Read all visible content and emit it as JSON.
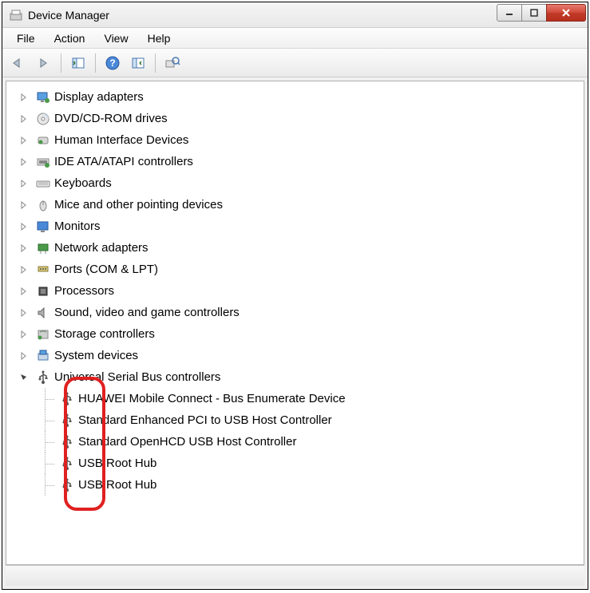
{
  "window": {
    "title": "Device Manager"
  },
  "menu": {
    "file": "File",
    "action": "Action",
    "view": "View",
    "help": "Help"
  },
  "toolbar": {
    "back": "back-icon",
    "forward": "forward-icon",
    "show_hide": "show-hide-tree-icon",
    "help": "help-icon",
    "action": "action-icon",
    "scan": "scan-hardware-icon"
  },
  "tree": [
    {
      "label": "Display adapters",
      "icon": "display",
      "expandable": true
    },
    {
      "label": "DVD/CD-ROM drives",
      "icon": "dvd",
      "expandable": true
    },
    {
      "label": "Human Interface Devices",
      "icon": "hid",
      "expandable": true
    },
    {
      "label": "IDE ATA/ATAPI controllers",
      "icon": "ide",
      "expandable": true
    },
    {
      "label": "Keyboards",
      "icon": "keyboard",
      "expandable": true
    },
    {
      "label": "Mice and other pointing devices",
      "icon": "mouse",
      "expandable": true
    },
    {
      "label": "Monitors",
      "icon": "monitor",
      "expandable": true
    },
    {
      "label": "Network adapters",
      "icon": "network",
      "expandable": true
    },
    {
      "label": "Ports (COM & LPT)",
      "icon": "ports",
      "expandable": true
    },
    {
      "label": "Processors",
      "icon": "cpu",
      "expandable": true
    },
    {
      "label": "Sound, video and game controllers",
      "icon": "sound",
      "expandable": true
    },
    {
      "label": "Storage controllers",
      "icon": "storage",
      "expandable": true
    },
    {
      "label": "System devices",
      "icon": "system",
      "expandable": true
    },
    {
      "label": "Universal Serial Bus controllers",
      "icon": "usb",
      "expanded": true,
      "children": [
        {
          "label": "HUAWEI Mobile Connect - Bus Enumerate Device",
          "icon": "usb"
        },
        {
          "label": "Standard Enhanced PCI to USB Host Controller",
          "icon": "usb"
        },
        {
          "label": "Standard OpenHCD USB Host Controller",
          "icon": "usb"
        },
        {
          "label": "USB Root Hub",
          "icon": "usb"
        },
        {
          "label": "USB Root Hub",
          "icon": "usb"
        }
      ]
    }
  ]
}
